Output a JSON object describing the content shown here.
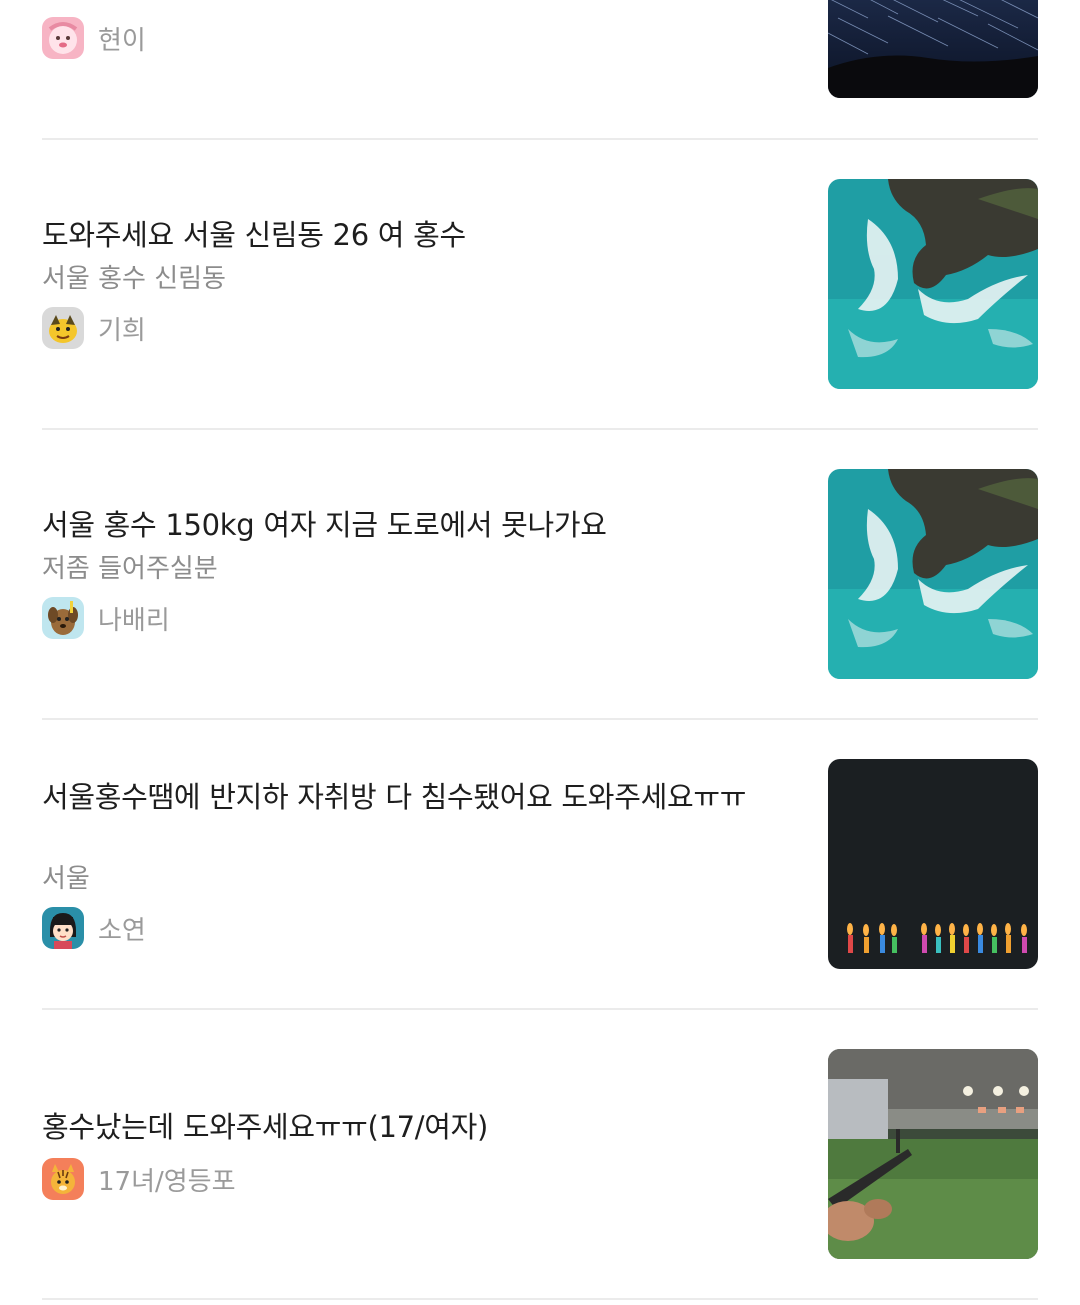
{
  "posts": [
    {
      "title": "",
      "subtitle": "",
      "author": "현이",
      "avatar_icon": "pink-character-avatar",
      "thumb_icon": "star-trails-night-photo"
    },
    {
      "title": "도와주세요 서울 신림동 26 여 홍수",
      "subtitle": "서울 홍수 신림동",
      "author": "기희",
      "avatar_icon": "yellow-character-avatar",
      "thumb_icon": "aerial-ocean-cliff-photo"
    },
    {
      "title": "서울 홍수 150kg 여자 지금 도로에서 못나가요",
      "subtitle": "저좀 들어주실분",
      "author": "나배리",
      "avatar_icon": "brown-dog-avatar",
      "thumb_icon": "aerial-ocean-cliff-photo"
    },
    {
      "title": "서울홍수땜에 반지하 자취방 다 침수됐어요 도와주세요ㅠㅠ",
      "subtitle": "서울",
      "author": "소연",
      "avatar_icon": "girl-character-avatar",
      "thumb_icon": "birthday-candles-photo"
    },
    {
      "title": "홍수났는데 도와주세요ㅠㅠ(17/여자)",
      "subtitle": "",
      "author": "17녀/영등포",
      "avatar_icon": "orange-tiger-avatar",
      "thumb_icon": "shooting-range-photo"
    }
  ],
  "colors": {
    "title": "#1e1e1e",
    "subtitle": "#8c8c8c",
    "author": "#9a9a9a",
    "divider": "#ebebeb",
    "background": "#ffffff"
  }
}
